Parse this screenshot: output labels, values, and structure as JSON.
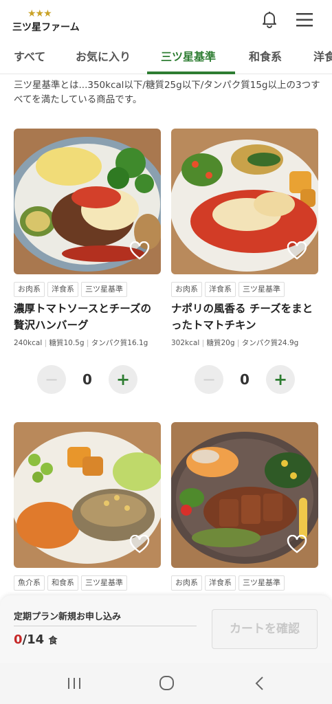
{
  "header": {
    "brand": "三ツ星ファーム",
    "stars": "★★★",
    "bell_icon": "bell-icon",
    "menu_icon": "hamburger-menu-icon"
  },
  "tabs": [
    {
      "label": "すべて"
    },
    {
      "label": "お気に入り"
    },
    {
      "label": "三ツ星基準",
      "active": true
    },
    {
      "label": "和食系"
    },
    {
      "label": "洋食"
    }
  ],
  "intro": "三ツ星基準とは...350kcal以下/糖質25g以下/タンパク質15g以上の3つすべてを満たしている商品です。",
  "products": [
    {
      "tags": [
        "お肉系",
        "洋食系",
        "三ツ星基準"
      ],
      "title": "濃厚トマトソースとチーズの贅沢ハンバーグ",
      "kcal": "240kcal",
      "sugar": "糖質10.5g",
      "protein": "タンパク質16.1g",
      "qty": "0"
    },
    {
      "tags": [
        "お肉系",
        "洋食系",
        "三ツ星基準"
      ],
      "title": "ナポリの風香る チーズをまとったトマトチキン",
      "kcal": "302kcal",
      "sugar": "糖質20g",
      "protein": "タンパク質24.9g",
      "qty": "0"
    },
    {
      "tags": [
        "魚介系",
        "和食系",
        "三ツ星基準"
      ]
    },
    {
      "tags": [
        "お肉系",
        "洋食系",
        "三ツ星基準"
      ]
    }
  ],
  "stepper": {
    "minus": "−",
    "plus": "+"
  },
  "bottom_bar": {
    "plan_label": "定期プラン新規お申し込み",
    "current": "0",
    "separator": "/",
    "total": "14",
    "unit": "食",
    "cart_button": "カートを確認"
  },
  "colors": {
    "accent_green": "#2e7d32",
    "count_red": "#c62828",
    "star_gold": "#c9a227"
  }
}
